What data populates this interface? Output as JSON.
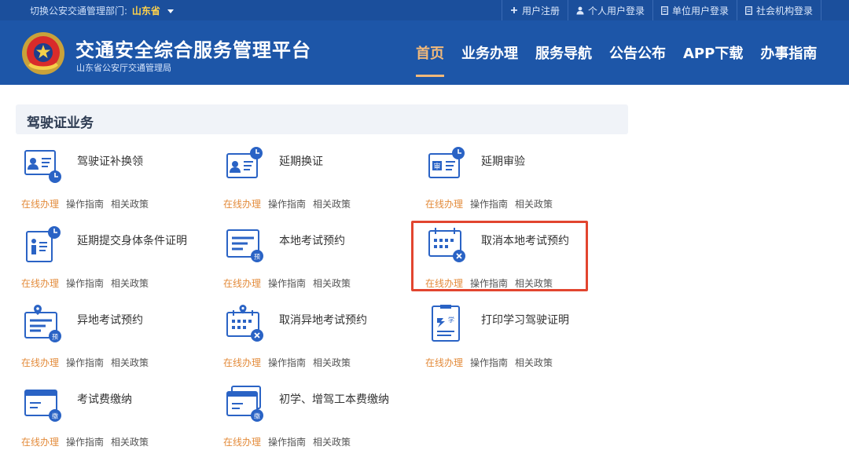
{
  "topbar": {
    "dept_label": "切换公安交通管理部门:",
    "province": "山东省",
    "links": [
      "用户注册",
      "个人用户登录",
      "单位用户登录",
      "社会机构登录"
    ]
  },
  "header": {
    "title": "交通安全综合服务管理平台",
    "subtitle": "山东省公安厅交通管理局",
    "nav": [
      "首页",
      "业务办理",
      "服务导航",
      "公告公布",
      "APP下载",
      "办事指南"
    ]
  },
  "section": {
    "title": "驾驶证业务"
  },
  "link_labels": {
    "online": "在线办理",
    "guide": "操作指南",
    "policy": "相关政策"
  },
  "services": [
    {
      "name": "驾驶证补换领",
      "icon": "id-card-clock-icon"
    },
    {
      "name": "延期换证",
      "icon": "id-card-clock-icon"
    },
    {
      "name": "延期审验",
      "icon": "review-card-clock-icon"
    },
    {
      "name": "延期提交身体条件证明",
      "icon": "person-document-clock-icon"
    },
    {
      "name": "本地考试预约",
      "icon": "exam-booking-icon"
    },
    {
      "name": "取消本地考试预约",
      "icon": "calendar-cancel-icon"
    },
    {
      "name": "异地考试预约",
      "icon": "location-exam-booking-icon"
    },
    {
      "name": "取消异地考试预约",
      "icon": "location-calendar-cancel-icon"
    },
    {
      "name": "打印学习驾驶证明",
      "icon": "learner-certificate-icon"
    },
    {
      "name": "考试费缴纳",
      "icon": "fee-payment-icon"
    },
    {
      "name": "初学、增驾工本费缴纳",
      "icon": "stacked-fee-payment-icon"
    }
  ],
  "colors": {
    "header_blue": "#1d56a8",
    "topbar_blue": "#1b4f9c",
    "active_nav": "#f2b97a",
    "online_orange": "#e38b3b",
    "highlight_red": "#e2452f",
    "icon_blue": "#2a63c5"
  }
}
